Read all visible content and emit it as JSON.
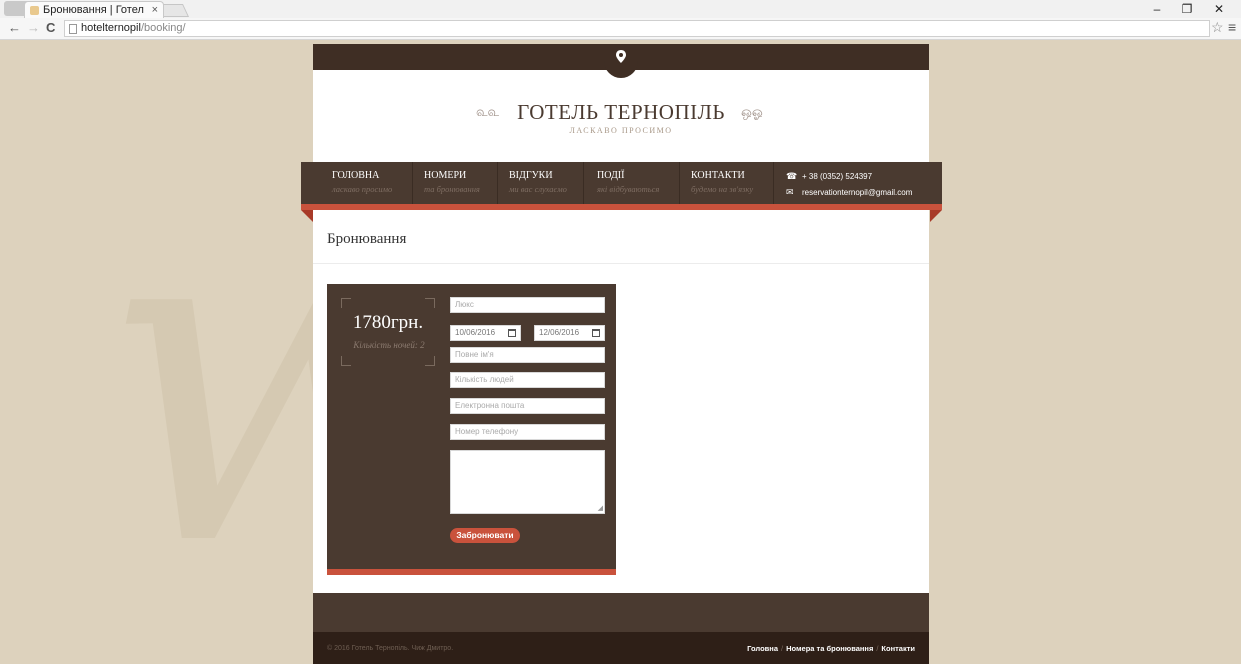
{
  "browser": {
    "tab_title": "Бронювання | Готел",
    "tab_close": "×",
    "url_host": "hotelternopil",
    "url_path": "/booking/",
    "back": "←",
    "forward": "→",
    "reload": "C",
    "star": "☆",
    "menu": "≡",
    "minimize": "–",
    "restore": "❐",
    "close": "✕"
  },
  "header": {
    "title": "ГОТЕЛЬ ТЕРНОПІЛЬ",
    "subtitle": "ЛАСКАВО ПРОСИМО",
    "ornament_left": "௳௳",
    "ornament_right": "ஒஓ"
  },
  "nav": [
    {
      "label": "ГОЛОВНА",
      "sub": "ласкаво просимо"
    },
    {
      "label": "НОМЕРИ",
      "sub": "та бронювання"
    },
    {
      "label": "ВІДГУКИ",
      "sub": "ми вас слухаємо"
    },
    {
      "label": "ПОДІЇ",
      "sub": "які відбуваються"
    },
    {
      "label": "КОНТАКТИ",
      "sub": "будемо на зв'язку"
    }
  ],
  "contact": {
    "phone": "+ 38 (0352) 524397",
    "email": "reservationternopil@gmail.com",
    "phone_icon": "☎",
    "email_icon": "✉"
  },
  "page": {
    "heading": "Бронювання"
  },
  "booking": {
    "price": "1780грн.",
    "nights": "Кількість ночей: 2",
    "room_type": "Люкс",
    "date_from": "10/06/2016",
    "date_to": "12/06/2016",
    "placeholder_name": "Повне ім'я",
    "placeholder_people": "Кількість людей",
    "placeholder_email": "Електронна пошта",
    "placeholder_phone": "Номер телефону",
    "submit_label": "Забронювати"
  },
  "footer": {
    "copyright": "© 2016 Готель Тернопіль. Чиж Дмитро.",
    "links": [
      "Головна",
      "Номера та бронювання",
      "Контакти"
    ],
    "sep": "/"
  },
  "colors": {
    "brown": "#4a3a30",
    "dark_brown": "#2e1f17",
    "accent_red": "#c9523c",
    "background": "#ddd2bd"
  }
}
